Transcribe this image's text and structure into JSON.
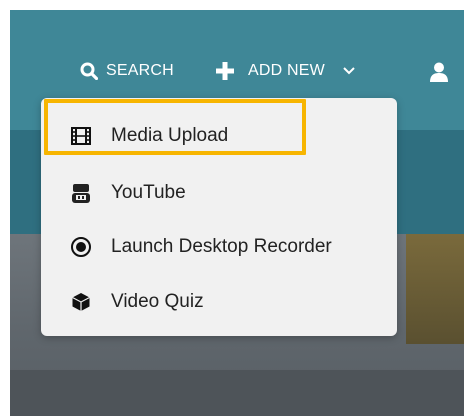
{
  "header": {
    "search_label": "SEARCH",
    "add_new_label": "ADD NEW",
    "icons": {
      "search": "search-icon",
      "add": "plus-icon",
      "dropdown": "chevron-down-icon",
      "user": "user-icon"
    }
  },
  "dropdown": {
    "items": [
      {
        "label": "Media Upload",
        "icon": "film-icon"
      },
      {
        "label": "YouTube",
        "icon": "youtube-icon"
      },
      {
        "label": "Launch Desktop Recorder",
        "icon": "record-icon"
      },
      {
        "label": "Video Quiz",
        "icon": "cube-icon"
      }
    ],
    "highlight_color": "#f7b500"
  },
  "colors": {
    "header_bg": "#3f8797",
    "subbar_bg": "#2f6f80",
    "dropdown_bg": "#f1f1f1"
  }
}
